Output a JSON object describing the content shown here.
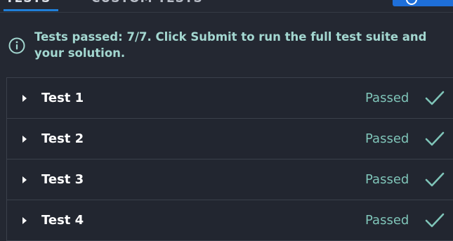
{
  "tabs": {
    "active_label": "TESTS",
    "inactive_label": "CUSTOM TESTS"
  },
  "info": {
    "message": "Tests passed: 7/7. Click Submit to run the full test suite and your solution.",
    "icon": "info-icon",
    "color": "#a3d7d0"
  },
  "tests": [
    {
      "name": "Test 1",
      "status": "Passed",
      "icon": "check-icon"
    },
    {
      "name": "Test 2",
      "status": "Passed",
      "icon": "check-icon"
    },
    {
      "name": "Test 3",
      "status": "Passed",
      "icon": "check-icon"
    },
    {
      "name": "Test 4",
      "status": "Passed",
      "icon": "check-icon"
    }
  ],
  "colors": {
    "background": "#242832",
    "accent": "#1f7fd8",
    "passed": "#7fc4b8"
  }
}
